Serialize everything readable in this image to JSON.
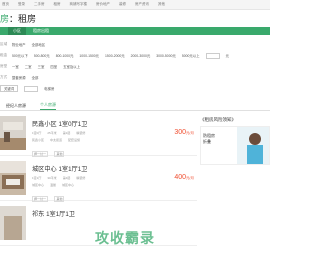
{
  "topbar": [
    "首页",
    "登录",
    "二手房",
    "租房",
    "商铺写字楼",
    "房价地产",
    "装修",
    "房产资讯",
    "其他"
  ],
  "brand": {
    "mark": "房",
    "title": "：租房"
  },
  "navbar": [
    {
      "label": "小区",
      "active": true
    },
    {
      "label": "租房出租",
      "active": false
    }
  ],
  "filters": {
    "row1": [
      "区域",
      "物业地产",
      "全部地区"
    ],
    "row2": [
      "租金",
      "500元以下",
      "500-800元",
      "800-1000元",
      "1000-1500元",
      "1500-2000元",
      "2000-3000元",
      "3000-5000元",
      "5000元以上",
      "元",
      "确定"
    ],
    "row3": [
      "房型",
      "一室",
      "二室",
      "三室",
      "四室",
      "五室及以上"
    ],
    "row4": [
      "方式",
      "整套房源",
      "全部"
    ],
    "row5": [
      "关键词",
      "电梯房"
    ]
  },
  "tabs": [
    {
      "label": "经纪人房源",
      "active": false
    },
    {
      "label": "个人房源",
      "active": true
    }
  ],
  "listings": [
    {
      "title": "民鑫小区 1室0厅1卫",
      "meta": [
        "1室0厅",
        "25平米",
        "第1层",
        "精装修"
      ],
      "meta2": [
        "民鑫小区",
        "中太街道",
        "配套设施"
      ],
      "tags": [
        "押一付一",
        "其他"
      ],
      "price": "300",
      "unit": "元/月"
    },
    {
      "title": "城区中心 1室1厅1卫",
      "meta": [
        "1室1厅",
        "30平米",
        "第4层",
        "精装修"
      ],
      "meta2": [
        "城区中心",
        "温馨",
        "城区中心"
      ],
      "tags": [
        "押一付一",
        "其他"
      ],
      "price": "400",
      "unit": "元/月"
    },
    {
      "title": "祁东 1室1厅1卫",
      "meta": [],
      "meta2": [],
      "tags": [],
      "price": "",
      "unit": ""
    }
  ],
  "aside": {
    "heading": "《租房风险须知》",
    "line1": "防租房",
    "line2": "租房",
    "line3": "折叠"
  },
  "watermark": "攻收霸录"
}
